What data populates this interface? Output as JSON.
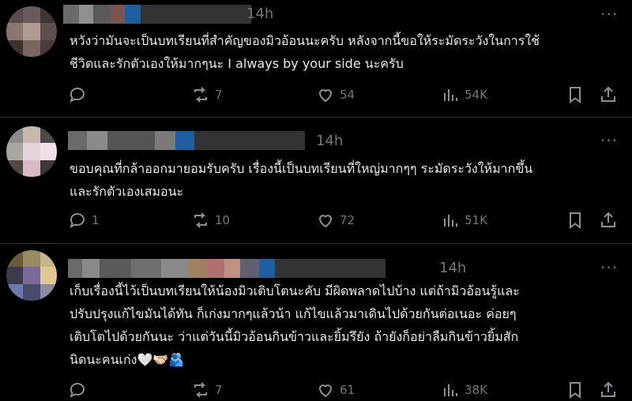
{
  "colors": {
    "background": "#000000",
    "text": "#e7e9ea",
    "muted": "#71767b",
    "divider": "#2f3336"
  },
  "replies": [
    {
      "author_blurred": true,
      "time": "14h",
      "more": "···",
      "text": "หวังว่ามันจะเป็นบทเรียนที่สำคัญของมิวอ้อนนะครับ หลังจากนี้ขอให้ระมัดระวังในการใช้\nชีวิตและรักตัวเองให้มากๆนะ I always by your side นะครับ",
      "replies_count": "",
      "reposts": "7",
      "likes": "54",
      "views": "54K",
      "icons": [
        "reply-icon",
        "repost-icon",
        "like-icon",
        "views-icon",
        "bookmark-icon",
        "share-icon"
      ]
    },
    {
      "author_blurred": true,
      "time": "14h",
      "more": "···",
      "text": "ขอบคุณที่กล้าออกมายอมรับครับ เรื่องนี้เป็นบทเรียนที่ใหญ่มากๆๆ ระมัดระวังให้มากขึ้น\nและรักตัวเองเสมอนะ",
      "replies_count": "1",
      "reposts": "10",
      "likes": "72",
      "views": "51K",
      "icons": [
        "reply-icon",
        "repost-icon",
        "like-icon",
        "views-icon",
        "bookmark-icon",
        "share-icon"
      ]
    },
    {
      "author_blurred": true,
      "time": "14h",
      "more": "···",
      "text": "เก็บเรื่องนี้ไว้เป็นบทเรียนให้น้องมิวเติบโตนะคับ มีผิดพลาดไปบ้าง แต่ถ้ามิวอ้อนรู้และ\nปรับปรุงแก้ไขมันได้ทัน ก็เก่งมากๆแล้วน้า แก้ไขแล้วมาเดินไปด้วยกันต่อเนอะ ค่อยๆ\nเติบโตไปด้วยกันนะ ว่าแต่วันนี้มิวอ้อนกินข้าวและยิ้มรึยัง ถ้ายังก็อย่าลืมกินข้าวยิ้มสัก\nนิดนะคนเก่ง🤍🫱🏻‍🫲🏼🫂",
      "replies_count": "",
      "reposts": "7",
      "likes": "61",
      "views": "38K",
      "icons": [
        "reply-icon",
        "repost-icon",
        "like-icon",
        "views-icon",
        "bookmark-icon",
        "share-icon"
      ]
    }
  ]
}
